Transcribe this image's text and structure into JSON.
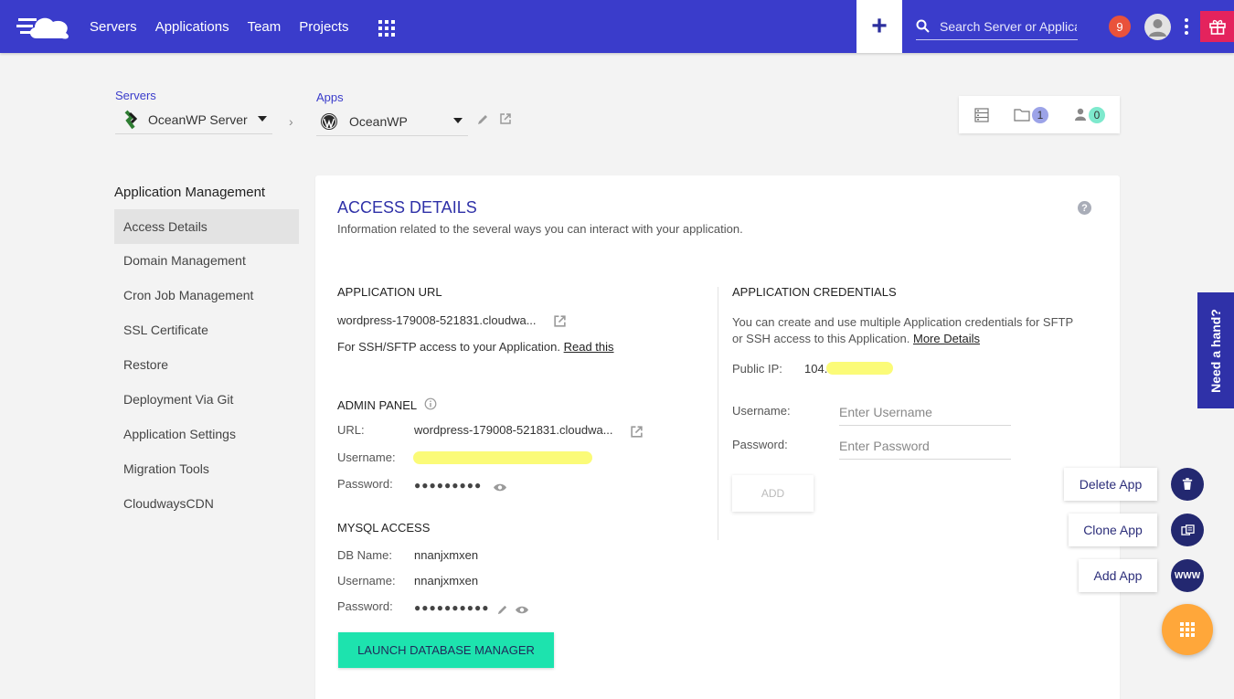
{
  "nav": {
    "items": [
      "Servers",
      "Applications",
      "Team",
      "Projects"
    ],
    "search_placeholder": "Search Server or Application",
    "notification_count": "9"
  },
  "breadcrumb": {
    "servers_label": "Servers",
    "server_name": "OceanWP Server",
    "apps_label": "Apps",
    "app_name": "OceanWP"
  },
  "quick": {
    "folder_count": "1",
    "user_count": "0"
  },
  "sidebar": {
    "title": "Application Management",
    "items": [
      "Access Details",
      "Domain Management",
      "Cron Job Management",
      "SSL Certificate",
      "Restore",
      "Deployment Via Git",
      "Application Settings",
      "Migration Tools",
      "CloudwaysCDN"
    ]
  },
  "main": {
    "title": "ACCESS DETAILS",
    "subtitle": "Information related to the several ways you can interact with your application.",
    "app_url": {
      "heading": "APPLICATION URL",
      "url": "wordpress-179008-521831.cloudwa...",
      "ssh_text": "For SSH/SFTP access to your Application.",
      "read_this": "Read this"
    },
    "admin": {
      "heading": "ADMIN PANEL",
      "url_label": "URL:",
      "url": "wordpress-179008-521831.cloudwa...",
      "username_label": "Username:",
      "password_label": "Password:",
      "password_mask": "●●●●●●●●●"
    },
    "mysql": {
      "heading": "MYSQL ACCESS",
      "dbname_label": "DB Name:",
      "dbname": "nnanjxmxen",
      "username_label": "Username:",
      "username": "nnanjxmxen",
      "password_label": "Password:",
      "password_mask": "●●●●●●●●●●",
      "launch_button": "LAUNCH DATABASE MANAGER"
    },
    "credentials": {
      "heading": "APPLICATION CREDENTIALS",
      "text_line1": "You can create and use multiple Application credentials for SFTP",
      "text_line2": "or SSH access to this Application.",
      "more_details": "More Details",
      "public_ip_label": "Public IP:",
      "public_ip": "104.",
      "username_label": "Username:",
      "username_placeholder": "Enter Username",
      "password_label": "Password:",
      "password_placeholder": "Enter Password",
      "add_button": "ADD"
    }
  },
  "floating": {
    "need_hand": "Need a hand?",
    "delete_app": "Delete App",
    "clone_app": "Clone App",
    "add_app": "Add App",
    "www": "WWW"
  },
  "colors": {
    "topbar": "#3a3ccb",
    "accent_green": "#1de3ae",
    "fab_orange": "#ffa73a",
    "gift_pink": "#e4235d"
  }
}
